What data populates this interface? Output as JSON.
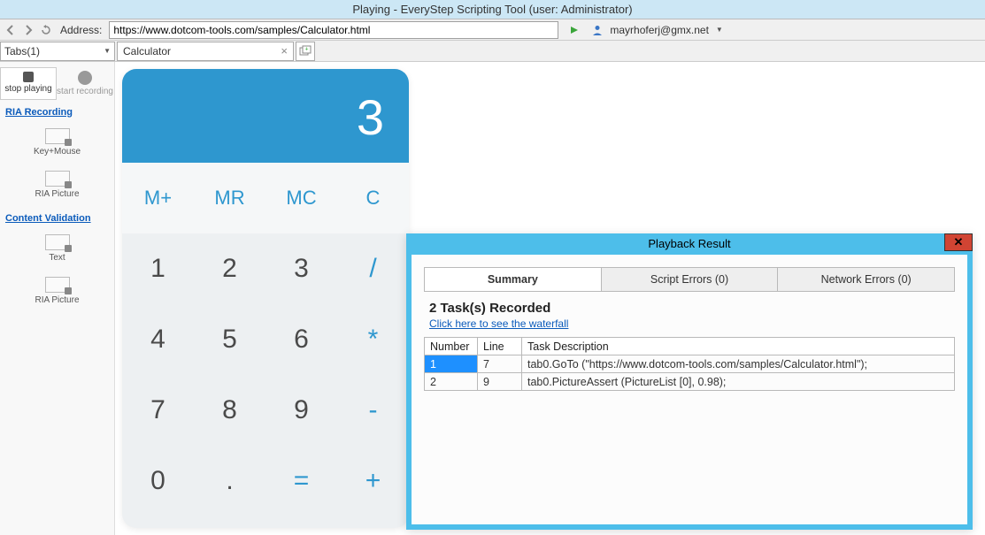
{
  "title_bar": "Playing - EveryStep Scripting Tool (user: Administrator)",
  "address": {
    "label": "Address:",
    "value": "https://www.dotcom-tools.com/samples/Calculator.html",
    "user": "mayrhoferj@gmx.net"
  },
  "tabs": {
    "dropdown": "Tabs(1)",
    "current": "Calculator"
  },
  "sidebar": {
    "stop": "stop playing",
    "start": "start recording",
    "ria_heading": "RIA Recording",
    "key_mouse": "Key+Mouse",
    "ria_picture": "RIA Picture",
    "content_heading": "Content Validation",
    "text_tool": "Text",
    "ria_picture2": "RIA Picture"
  },
  "calc": {
    "display": "3",
    "mem": [
      "M+",
      "MR",
      "MC",
      "C"
    ],
    "rows": [
      [
        "1",
        "2",
        "3",
        "/"
      ],
      [
        "4",
        "5",
        "6",
        "*"
      ],
      [
        "7",
        "8",
        "9",
        "-"
      ],
      [
        "0",
        ".",
        "=",
        "+"
      ]
    ]
  },
  "playback": {
    "title": "Playback Result",
    "tabs": [
      "Summary",
      "Script Errors (0)",
      "Network Errors (0)"
    ],
    "header": "2 Task(s) Recorded",
    "waterfall_link": "Click here to see the waterfall",
    "cols": [
      "Number",
      "Line",
      "Task Description"
    ],
    "rows": [
      {
        "num": "1",
        "line": "7",
        "desc": "tab0.GoTo (\"https://www.dotcom-tools.com/samples/Calculator.html\");"
      },
      {
        "num": "2",
        "line": "9",
        "desc": "tab0.PictureAssert (PictureList [0], 0.98);"
      }
    ]
  },
  "chart_data": {
    "type": "table",
    "title": "Playback Result",
    "columns": [
      "Number",
      "Line",
      "Task Description"
    ],
    "rows": [
      [
        1,
        7,
        "tab0.GoTo (\"https://www.dotcom-tools.com/samples/Calculator.html\");"
      ],
      [
        2,
        9,
        "tab0.PictureAssert (PictureList [0], 0.98);"
      ]
    ]
  }
}
